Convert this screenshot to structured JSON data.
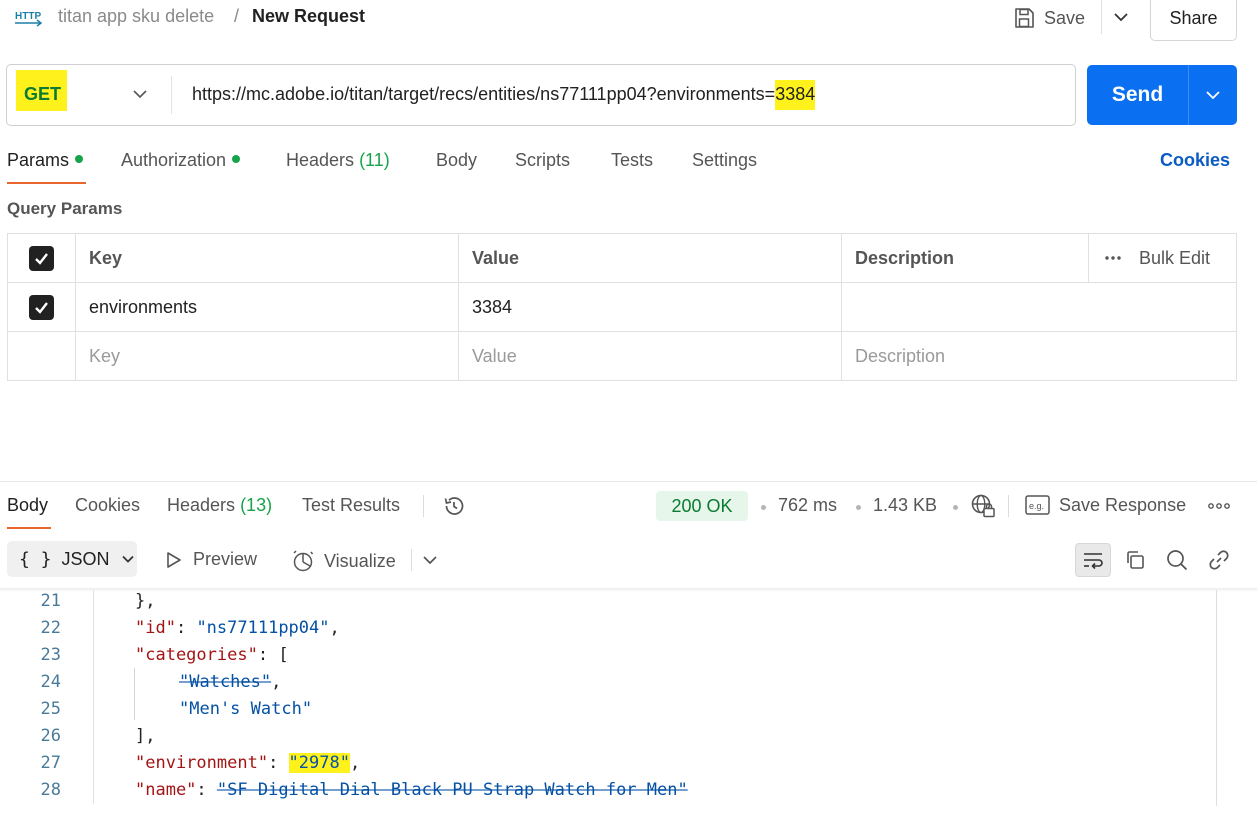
{
  "header": {
    "icon_label": "HTTP",
    "breadcrumb_parent": "titan app sku delete",
    "breadcrumb_separator": "/",
    "breadcrumb_current": "New Request",
    "save_label": "Save",
    "share_label": "Share"
  },
  "request": {
    "method": "GET",
    "url_before_value": "https://mc.adobe.io/titan/target/recs/entities/ns77111pp04?environments=",
    "url_highlighted_value": "3384",
    "send_label": "Send"
  },
  "request_tabs": {
    "params": "Params",
    "authorization": "Authorization",
    "headers": "Headers",
    "headers_count": "(11)",
    "body": "Body",
    "scripts": "Scripts",
    "tests": "Tests",
    "settings": "Settings",
    "cookies": "Cookies"
  },
  "query_params": {
    "title": "Query Params",
    "columns": {
      "key": "Key",
      "value": "Value",
      "description": "Description",
      "bulk_edit": "Bulk Edit"
    },
    "rows": [
      {
        "checked": true,
        "key": "environments",
        "value": "3384",
        "description": ""
      }
    ],
    "placeholders": {
      "key": "Key",
      "value": "Value",
      "description": "Description"
    }
  },
  "response": {
    "tabs": {
      "body": "Body",
      "cookies": "Cookies",
      "headers": "Headers",
      "headers_count": "(13)",
      "test_results": "Test Results"
    },
    "status": "200 OK",
    "time": "762 ms",
    "size": "1.43 KB",
    "save_response": "Save Response",
    "format": "JSON",
    "format_braces": "{ }",
    "preview": "Preview",
    "visualize": "Visualize",
    "colors": {
      "status_green": "#0b7a32",
      "send_blue": "#0a6ff0",
      "highlight": "#fff21c",
      "tab_accent": "#e8672f"
    }
  },
  "code": {
    "line_numbers": [
      "21",
      "22",
      "23",
      "24",
      "25",
      "26",
      "27",
      "28"
    ],
    "line21": "},",
    "id_key": "\"id\"",
    "id_value": "\"ns77111pp04\"",
    "categories_key": "\"categories\"",
    "categories_open": "[",
    "cat1": "\"Watches\"",
    "cat2": "\"Men's Watch\"",
    "categories_close": "],",
    "environment_key": "\"environment\"",
    "environment_value": "\"2978\"",
    "name_key": "\"name\"",
    "name_value": "\"SF Digital Dial Black PU Strap Watch for Men\""
  }
}
